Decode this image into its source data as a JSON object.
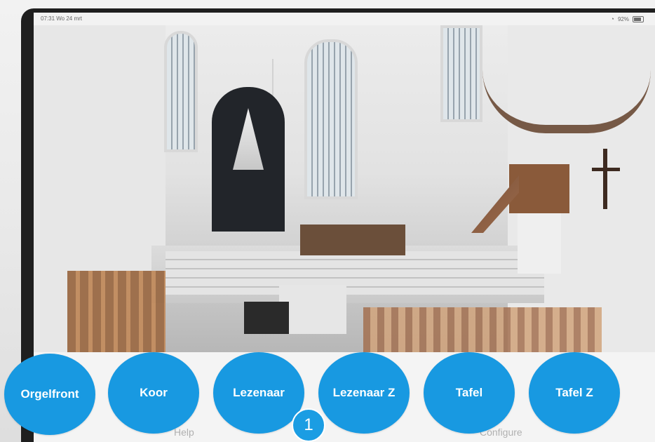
{
  "status_bar": {
    "time_date": "07:31  Wo 24 mrt",
    "battery": "92%"
  },
  "presets": [
    {
      "label": "Orgelfront"
    },
    {
      "label": "Koor"
    },
    {
      "label": "Lezenaar"
    },
    {
      "label": "Lezenaar Z"
    },
    {
      "label": "Tafel"
    },
    {
      "label": "Tafel Z"
    }
  ],
  "pager": {
    "current_page": "1"
  },
  "bottom_labels": {
    "help": "Help",
    "configure": "Configure"
  },
  "colors": {
    "preset_button": "#1899e1",
    "page_badge": "#1b9de3"
  }
}
